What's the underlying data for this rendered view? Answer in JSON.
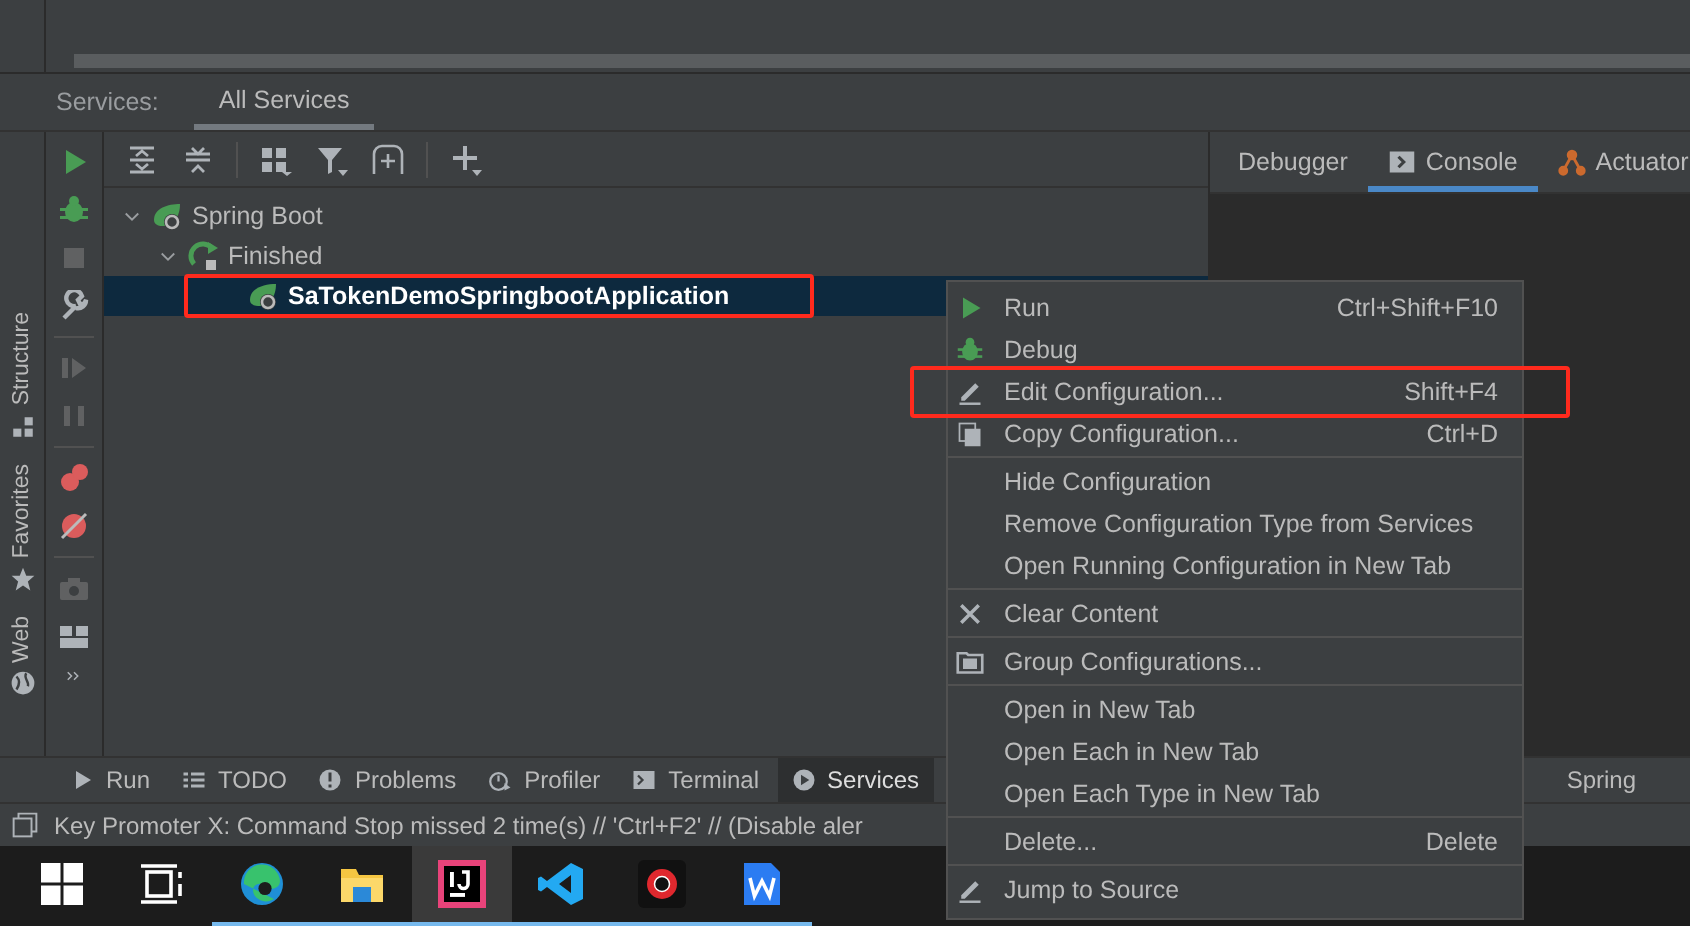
{
  "services": {
    "label": "Services:",
    "tabs": [
      {
        "label": "All Services",
        "selected": true
      }
    ]
  },
  "tree": [
    {
      "kind": "type",
      "label": "Spring Boot",
      "expanded": true,
      "selected": false,
      "highlighted": false,
      "children": [
        {
          "kind": "status",
          "label": "Finished",
          "expanded": true,
          "selected": false,
          "highlighted": false,
          "children": [
            {
              "kind": "app",
              "label": "SaTokenDemoSpringbootApplication",
              "selected": true,
              "highlighted": true
            }
          ]
        }
      ]
    }
  ],
  "detail_tabs": [
    {
      "label": "Debugger",
      "selected": false
    },
    {
      "label": "Console",
      "selected": true
    },
    {
      "label": "Actuator",
      "selected": false
    }
  ],
  "run_toolbar": [
    {
      "disabled": false
    },
    {
      "disabled": false
    },
    {
      "disabled": true
    },
    {
      "disabled": false
    },
    {
      "disabled": true
    },
    {
      "disabled": true
    },
    {
      "disabled": false
    },
    {
      "disabled": false
    },
    {
      "disabled": true
    },
    {
      "disabled": false
    }
  ],
  "side_stripe": [
    {
      "label": "Structure"
    },
    {
      "label": "Favorites"
    },
    {
      "label": "Web"
    }
  ],
  "tool_windows": [
    {
      "label": "Run",
      "selected": false
    },
    {
      "label": "TODO",
      "selected": false
    },
    {
      "label": "Problems",
      "selected": false
    },
    {
      "label": "Profiler",
      "selected": false
    },
    {
      "label": "Terminal",
      "selected": false
    },
    {
      "label": "Services",
      "selected": true
    }
  ],
  "right_tool_windows": [
    {
      "label": "Spring",
      "selected": false
    }
  ],
  "status_bar": {
    "message": "Key Promoter X: Command Stop missed 2 time(s) // 'Ctrl+F2' // (Disable aler"
  },
  "context_menu": {
    "items": [
      {
        "kind": "item",
        "label": "Run",
        "shortcut": "Ctrl+Shift+F10",
        "highlighted": false
      },
      {
        "kind": "item",
        "label": "Debug",
        "highlighted": false
      },
      {
        "kind": "item",
        "label": "Edit Configuration...",
        "shortcut": "Shift+F4",
        "highlighted": true
      },
      {
        "kind": "item",
        "label": "Copy Configuration...",
        "shortcut": "Ctrl+D",
        "highlighted": false
      },
      {
        "kind": "separator"
      },
      {
        "kind": "item",
        "label": "Hide Configuration",
        "highlighted": false
      },
      {
        "kind": "item",
        "label": "Remove Configuration Type from Services",
        "highlighted": false
      },
      {
        "kind": "item",
        "label": "Open Running Configuration in New Tab",
        "highlighted": false
      },
      {
        "kind": "separator"
      },
      {
        "kind": "item",
        "label": "Clear Content",
        "highlighted": false
      },
      {
        "kind": "separator"
      },
      {
        "kind": "item",
        "label": "Group Configurations...",
        "highlighted": false
      },
      {
        "kind": "separator"
      },
      {
        "kind": "item",
        "label": "Open in New Tab",
        "highlighted": false
      },
      {
        "kind": "item",
        "label": "Open Each in New Tab",
        "highlighted": false
      },
      {
        "kind": "item",
        "label": "Open Each Type in New Tab",
        "highlighted": false
      },
      {
        "kind": "separator"
      },
      {
        "kind": "item",
        "label": "Delete...",
        "shortcut": "Delete",
        "highlighted": false
      },
      {
        "kind": "separator"
      },
      {
        "kind": "item",
        "label": "Jump to Source",
        "highlighted": false
      }
    ]
  },
  "taskbar": {
    "apps": [
      {
        "selected": false,
        "running": false
      },
      {
        "selected": false,
        "running": false
      },
      {
        "selected": false,
        "running": true
      },
      {
        "selected": false,
        "running": true
      },
      {
        "selected": true,
        "running": true
      },
      {
        "selected": false,
        "running": true
      },
      {
        "selected": false,
        "running": true
      },
      {
        "selected": false,
        "running": true
      }
    ]
  }
}
